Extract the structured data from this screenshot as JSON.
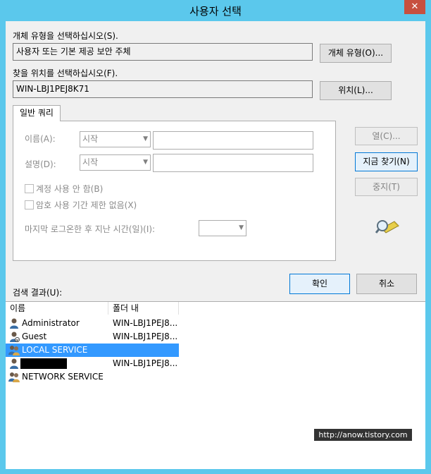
{
  "window": {
    "title": "사용자 선택",
    "close": "✕"
  },
  "object_type": {
    "label": "개체 유형을 선택하십시오(S).",
    "value": "사용자 또는 기본 제공 보안 주체",
    "button": "개체 유형(O)..."
  },
  "location": {
    "label": "찾을 위치를 선택하십시오(F).",
    "value": "WIN-LBJ1PEJ8K71",
    "button": "위치(L)..."
  },
  "query": {
    "tab": "일반 쿼리",
    "name_label": "이름(A):",
    "name_mode": "시작",
    "desc_label": "설명(D):",
    "desc_mode": "시작",
    "disabled_accounts": "계정 사용 안 함(B)",
    "non_expiring": "암호 사용 기간 제한 없음(X)",
    "days_since_logon": "마지막 로그온한 후 지난 시간(일)(I):"
  },
  "buttons": {
    "columns": "열(C)...",
    "find_now": "지금 찾기(N)",
    "stop": "중지(T)",
    "ok": "확인",
    "cancel": "취소"
  },
  "results": {
    "label": "검색 결과(U):",
    "columns": [
      "이름",
      "폴더 내"
    ],
    "rows": [
      {
        "name": "Administrator",
        "folder": "WIN-LBJ1PEJ8...",
        "icon": "user-icon"
      },
      {
        "name": "Guest",
        "folder": "WIN-LBJ1PEJ8...",
        "icon": "user-icon"
      },
      {
        "name": "LOCAL SERVICE",
        "folder": "",
        "icon": "group-icon",
        "selected": true
      },
      {
        "name": "",
        "folder": "WIN-LBJ1PEJ8...",
        "icon": "user-icon",
        "redacted": true
      },
      {
        "name": "NETWORK SERVICE",
        "folder": "",
        "icon": "group-icon"
      }
    ]
  },
  "watermark": "http://anow.tistory.com",
  "colors": {
    "titlebar": "#5bc8ec",
    "close": "#c7503f",
    "selection": "#3399ff",
    "focus_border": "#0078d7"
  }
}
